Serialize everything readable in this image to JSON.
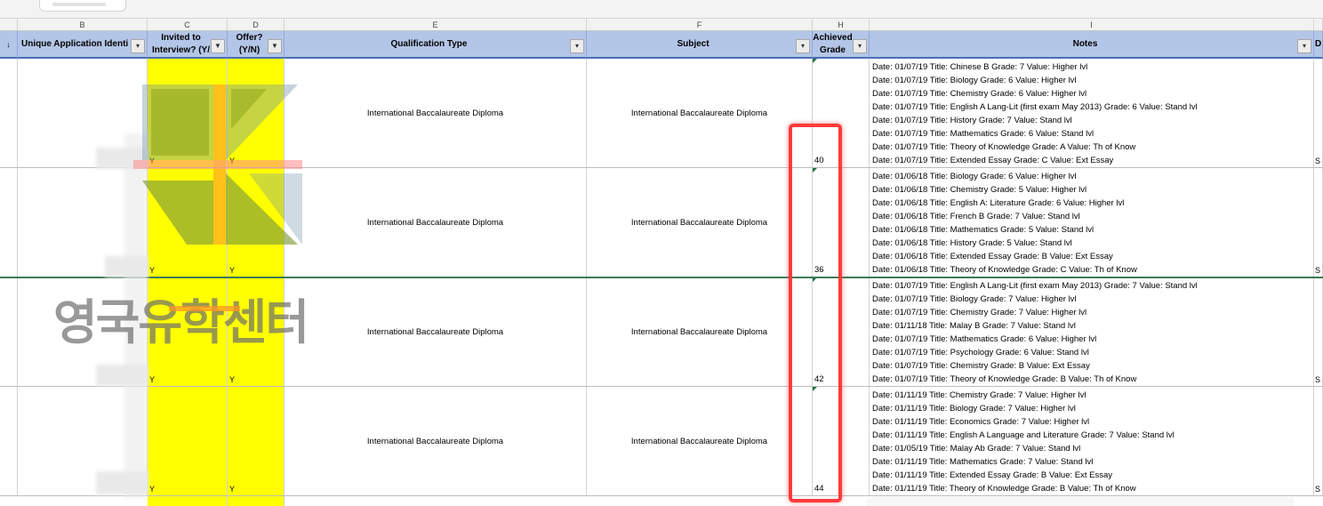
{
  "col_letters": [
    "B",
    "C",
    "D",
    "E",
    "F",
    "H",
    "I"
  ],
  "headers": {
    "sort": "↓",
    "uid": "Unique Application Identi",
    "invited": "Invited to Interview? (Y/",
    "offer": "Offer? (Y/N)",
    "qual": "Qualification Type",
    "subject": "Subject",
    "grade": "Achieved Grade",
    "notes": "Notes",
    "extra": "D"
  },
  "filter_icon": "filter-funnel-icon",
  "dropdown_icon": "dropdown-arrow-icon",
  "rows": [
    {
      "invited": "Y",
      "offer": "Y",
      "qual": "International Baccalaureate Diploma",
      "subject": "International Baccalaureate Diploma",
      "grade": "40",
      "notes": [
        "Date: 01/07/19 Title: Chinese B Grade: 7 Value: Higher lvl",
        "Date: 01/07/19 Title: Biology Grade: 6 Value: Higher lvl",
        "Date: 01/07/19 Title: Chemistry Grade: 6 Value: Higher lvl",
        "Date: 01/07/19 Title: English A Lang-Lit (first exam May 2013) Grade: 6 Value: Stand lvl",
        "Date: 01/07/19 Title: History Grade: 7 Value: Stand lvl",
        "Date: 01/07/19 Title: Mathematics Grade: 6 Value: Stand lvl",
        "Date: 01/07/19 Title: Theory of Knowledge Grade: A Value: Th of Know",
        "Date: 01/07/19 Title: Extended Essay Grade: C Value: Ext Essay"
      ],
      "extra": "S"
    },
    {
      "invited": "Y",
      "offer": "Y",
      "qual": "International Baccalaureate Diploma",
      "subject": "International Baccalaureate Diploma",
      "grade": "36",
      "notes": [
        "Date: 01/06/18 Title: Biology Grade: 6 Value: Higher lvl",
        "Date: 01/06/18 Title: Chemistry Grade: 5 Value: Higher lvl",
        "Date: 01/06/18 Title: English A: Literature Grade: 6 Value: Higher lvl",
        "Date: 01/06/18 Title: French B Grade: 7 Value: Stand lvl",
        "Date: 01/06/18 Title: Mathematics Grade: 5 Value: Stand lvl",
        "Date: 01/06/18 Title: History Grade: 5 Value: Stand lvl",
        "Date: 01/06/18 Title: Extended Essay Grade: B Value: Ext Essay",
        "Date: 01/06/18 Title: Theory of Knowledge Grade: C Value: Th of Know"
      ],
      "extra": "S"
    },
    {
      "invited": "Y",
      "offer": "Y",
      "qual": "International Baccalaureate Diploma",
      "subject": "International Baccalaureate Diploma",
      "grade": "42",
      "notes": [
        "Date: 01/07/19 Title: English A Lang-Lit (first exam May 2013) Grade: 7 Value: Stand lvl",
        "Date: 01/07/19 Title: Biology Grade: 7 Value: Higher lvl",
        "Date: 01/07/19 Title: Chemistry Grade: 7 Value: Higher lvl",
        "Date: 01/11/18 Title: Malay B Grade: 7 Value: Stand lvl",
        "Date: 01/07/19 Title: Mathematics Grade: 6 Value: Higher lvl",
        "Date: 01/07/19 Title: Psychology Grade: 6 Value: Stand lvl",
        "Date: 01/07/19 Title: Chemistry Grade: B Value: Ext Essay",
        "Date: 01/07/19 Title: Theory of Knowledge Grade: B Value: Th of Know"
      ],
      "extra": "S"
    },
    {
      "invited": "Y",
      "offer": "Y",
      "qual": "International Baccalaureate Diploma",
      "subject": "International Baccalaureate Diploma",
      "grade": "44",
      "notes": [
        "Date: 01/11/19 Title: Chemistry Grade: 7 Value: Higher lvl",
        "Date: 01/11/19 Title: Biology Grade: 7 Value: Higher lvl",
        "Date: 01/11/19 Title: Economics Grade: 7 Value: Higher lvl",
        "Date: 01/11/19 Title: English A Language and Literature Grade: 7 Value: Stand lvl",
        "Date: 01/05/19 Title: Malay Ab Grade: 7 Value: Stand lvl",
        "Date: 01/11/19 Title: Mathematics Grade: 7 Value: Stand lvl",
        "Date: 01/11/19 Title: Extended Essay Grade: B Value: Ext Essay",
        "Date: 01/11/19 Title: Theory of Knowledge Grade: B Value: Th of Know"
      ],
      "extra": "S"
    }
  ],
  "watermark": "영국유학센터",
  "colors": {
    "header_bg": "#b4c6e7",
    "highlight": "#ffff00",
    "annotation": "#ff3b3b",
    "row_divider": "#3d7a55"
  }
}
